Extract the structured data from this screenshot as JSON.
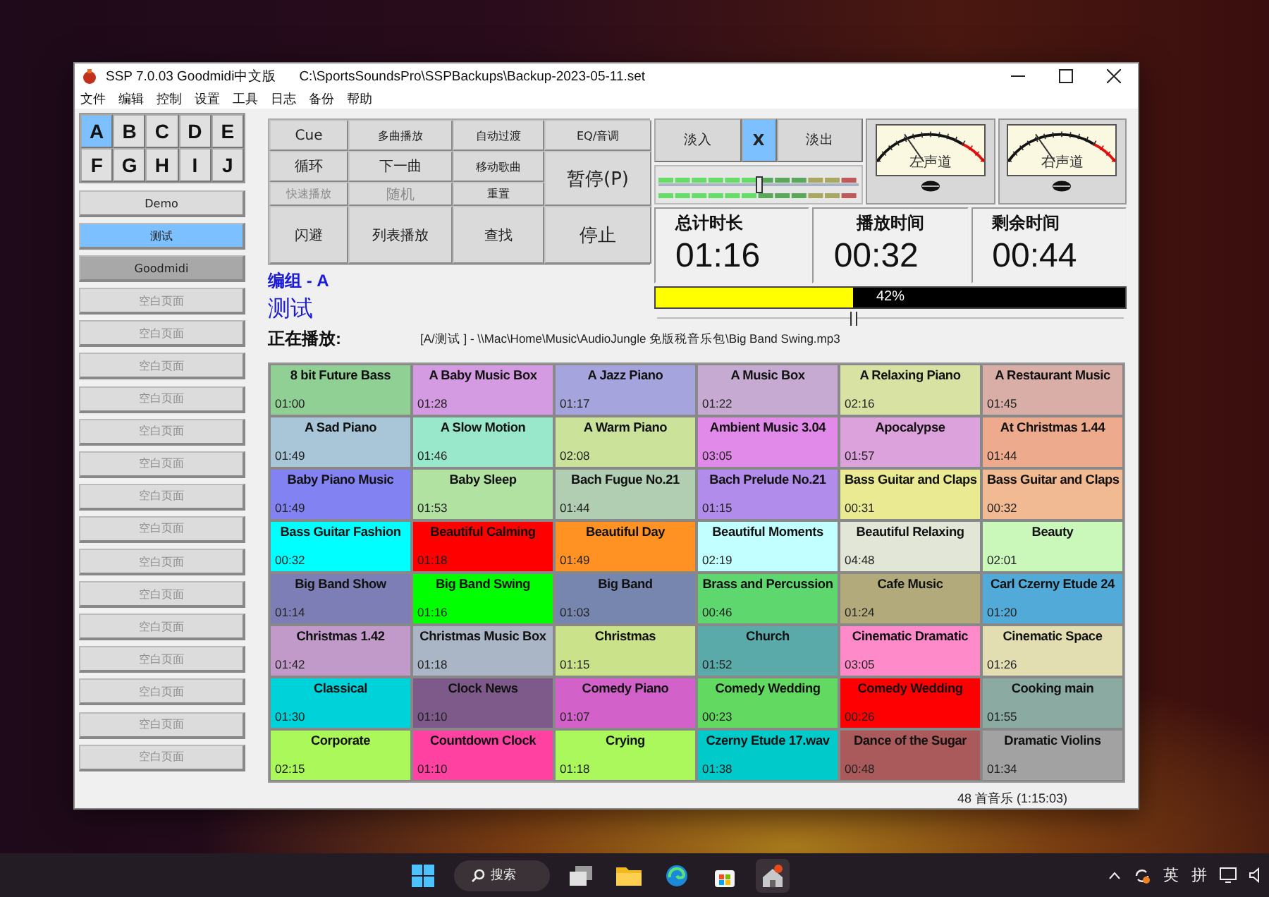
{
  "window": {
    "title": "SSP 7.0.03 Goodmidi中文版",
    "file_path": "C:\\SportsSoundsPro\\SSPBackups\\Backup-2023-05-11.set"
  },
  "menu": [
    "文件",
    "编辑",
    "控制",
    "设置",
    "工具",
    "日志",
    "备份",
    "帮助"
  ],
  "letters": [
    {
      "label": "A",
      "selected": true
    },
    {
      "label": "B",
      "selected": false
    },
    {
      "label": "C",
      "selected": false
    },
    {
      "label": "D",
      "selected": false
    },
    {
      "label": "E",
      "selected": false
    },
    {
      "label": "F",
      "selected": false
    },
    {
      "label": "G",
      "selected": false
    },
    {
      "label": "H",
      "selected": false
    },
    {
      "label": "I",
      "selected": false
    },
    {
      "label": "J",
      "selected": false
    }
  ],
  "pages": [
    {
      "label": "Demo",
      "selected": false,
      "shaded": false,
      "disabled": false
    },
    {
      "label": "测试",
      "selected": true,
      "shaded": false,
      "disabled": false
    },
    {
      "label": "Goodmidi",
      "selected": false,
      "shaded": true,
      "disabled": false
    },
    {
      "label": "空白页面",
      "selected": false,
      "shaded": false,
      "disabled": true
    },
    {
      "label": "空白页面",
      "selected": false,
      "shaded": false,
      "disabled": true
    },
    {
      "label": "空白页面",
      "selected": false,
      "shaded": false,
      "disabled": true
    },
    {
      "label": "空白页面",
      "selected": false,
      "shaded": false,
      "disabled": true
    },
    {
      "label": "空白页面",
      "selected": false,
      "shaded": false,
      "disabled": true
    },
    {
      "label": "空白页面",
      "selected": false,
      "shaded": false,
      "disabled": true
    },
    {
      "label": "空白页面",
      "selected": false,
      "shaded": false,
      "disabled": true
    },
    {
      "label": "空白页面",
      "selected": false,
      "shaded": false,
      "disabled": true
    },
    {
      "label": "空白页面",
      "selected": false,
      "shaded": false,
      "disabled": true
    },
    {
      "label": "空白页面",
      "selected": false,
      "shaded": false,
      "disabled": true
    },
    {
      "label": "空白页面",
      "selected": false,
      "shaded": false,
      "disabled": true
    },
    {
      "label": "空白页面",
      "selected": false,
      "shaded": false,
      "disabled": true
    },
    {
      "label": "空白页面",
      "selected": false,
      "shaded": false,
      "disabled": true
    },
    {
      "label": "空白页面",
      "selected": false,
      "shaded": false,
      "disabled": true
    },
    {
      "label": "空白页面",
      "selected": false,
      "shaded": false,
      "disabled": true
    }
  ],
  "controls": [
    {
      "label": "Cue",
      "kind": "normal",
      "disabled": false
    },
    {
      "label": "多曲播放",
      "kind": "small",
      "disabled": false
    },
    {
      "label": "自动过渡",
      "kind": "small",
      "disabled": false
    },
    {
      "label": "EQ/音调",
      "kind": "small",
      "disabled": false
    },
    {
      "label": "循环",
      "kind": "normal",
      "disabled": false
    },
    {
      "label": "下一曲",
      "kind": "normal",
      "disabled": false
    },
    {
      "label": "移动歌曲",
      "kind": "small",
      "disabled": false
    },
    {
      "label": "暂停(P)",
      "kind": "large",
      "disabled": false
    },
    {
      "label": "快速播放",
      "kind": "small",
      "disabled": true
    },
    {
      "label": "随机",
      "kind": "normal",
      "disabled": true
    },
    {
      "label": "重置",
      "kind": "small",
      "disabled": false
    },
    {
      "label": "闪避",
      "kind": "normal",
      "disabled": false
    },
    {
      "label": "列表播放",
      "kind": "normal",
      "disabled": false
    },
    {
      "label": "查找",
      "kind": "normal",
      "disabled": false
    },
    {
      "label": "停止",
      "kind": "large",
      "disabled": false
    }
  ],
  "group": {
    "label": "编组 - A",
    "page": "测试"
  },
  "fade_buttons": [
    {
      "label": "淡入",
      "selected": false
    },
    {
      "label": "X",
      "selected": true
    },
    {
      "label": "淡出",
      "selected": false
    }
  ],
  "mixer": {
    "level": 0.5
  },
  "vu_meters": [
    {
      "label": "左声道"
    },
    {
      "label": "右声道"
    }
  ],
  "timers": [
    {
      "label": "总计时长",
      "value": "01:16"
    },
    {
      "label": "播放时间",
      "value": "00:32"
    },
    {
      "label": "剩余时间",
      "value": "00:44"
    }
  ],
  "progress": {
    "level": 0.42,
    "text": "42%"
  },
  "seek": {
    "level": 0.42
  },
  "now_playing": {
    "label": "正在播放:",
    "path": "[A/测试 ] - \\\\Mac\\Home\\Music\\AudioJungle 免版税音乐包\\Big Band Swing.mp3"
  },
  "tracks": [
    {
      "title": "8 bit Future Bass",
      "time": "01:00",
      "color": "#90d094"
    },
    {
      "title": "A Baby Music Box",
      "time": "01:28",
      "color": "#d49ae2"
    },
    {
      "title": "A Jazz Piano",
      "time": "01:17",
      "color": "#a6a4dc"
    },
    {
      "title": "A Music Box",
      "time": "01:22",
      "color": "#c6aad2"
    },
    {
      "title": "A Relaxing Piano",
      "time": "02:16",
      "color": "#d8e2a2"
    },
    {
      "title": "A Restaurant Music",
      "time": "01:45",
      "color": "#d8aea6"
    },
    {
      "title": "A Sad Piano",
      "time": "01:49",
      "color": "#a8c6d8"
    },
    {
      "title": "A Slow Motion",
      "time": "01:46",
      "color": "#9ae8cc"
    },
    {
      "title": "A Warm Piano",
      "time": "02:08",
      "color": "#cae29a"
    },
    {
      "title": "Ambient Music 3.04",
      "time": "03:05",
      "color": "#e28aea"
    },
    {
      "title": "Apocalypse",
      "time": "01:57",
      "color": "#dca2dc"
    },
    {
      "title": "At Christmas 1.44",
      "time": "01:44",
      "color": "#eeaa8c"
    },
    {
      "title": "Baby Piano Music",
      "time": "01:49",
      "color": "#8282f2"
    },
    {
      "title": "Baby Sleep",
      "time": "01:53",
      "color": "#b2e2a2"
    },
    {
      "title": "Bach Fugue No.21",
      "time": "01:44",
      "color": "#b2ceb2"
    },
    {
      "title": "Bach Prelude No.21",
      "time": "01:15",
      "color": "#b28cea"
    },
    {
      "title": "Bass Guitar and Claps",
      "time": "00:31",
      "color": "#eaea92"
    },
    {
      "title": "Bass Guitar and Claps",
      "time": "00:32",
      "color": "#f2ba92"
    },
    {
      "title": "Bass Guitar Fashion",
      "time": "00:32",
      "color": "#00ffff"
    },
    {
      "title": "Beautiful Calming",
      "time": "01:18",
      "color": "#ff0000"
    },
    {
      "title": "Beautiful Day",
      "time": "01:49",
      "color": "#ff9222"
    },
    {
      "title": "Beautiful Moments",
      "time": "02:19",
      "color": "#c2ffff"
    },
    {
      "title": "Beautiful Relaxing",
      "time": "04:48",
      "color": "#e2e6d6"
    },
    {
      "title": "Beauty",
      "time": "02:01",
      "color": "#caf8ba"
    },
    {
      "title": "Big Band Show",
      "time": "01:14",
      "color": "#7e7eb6"
    },
    {
      "title": "Big Band Swing",
      "time": "01:16",
      "color": "#00ff00"
    },
    {
      "title": "Big Band",
      "time": "01:03",
      "color": "#7686ae"
    },
    {
      "title": "Brass and Percussion",
      "time": "00:46",
      "color": "#5ed86e"
    },
    {
      "title": "Cafe Music",
      "time": "01:24",
      "color": "#b2aa7a"
    },
    {
      "title": "Carl Czerny Etude 24",
      "time": "01:20",
      "color": "#52aad8"
    },
    {
      "title": "Christmas 1.42",
      "time": "01:42",
      "color": "#c29aca"
    },
    {
      "title": "Christmas Music Box",
      "time": "01:18",
      "color": "#aab6c6"
    },
    {
      "title": "Christmas",
      "time": "01:15",
      "color": "#cae28a"
    },
    {
      "title": "Church",
      "time": "01:52",
      "color": "#5aaaaa"
    },
    {
      "title": "Cinematic Dramatic",
      "time": "03:05",
      "color": "#ff8aca"
    },
    {
      "title": "Cinematic Space",
      "time": "01:26",
      "color": "#e2deb2"
    },
    {
      "title": "Classical",
      "time": "01:30",
      "color": "#00d2da"
    },
    {
      "title": "Clock News",
      "time": "01:10",
      "color": "#7e5a8a"
    },
    {
      "title": "Comedy Piano",
      "time": "01:07",
      "color": "#d262ca"
    },
    {
      "title": "Comedy Wedding",
      "time": "00:23",
      "color": "#62da62"
    },
    {
      "title": "Comedy Wedding",
      "time": "00:26",
      "color": "#ff0002"
    },
    {
      "title": "Cooking main",
      "time": "01:55",
      "color": "#8aaaa2"
    },
    {
      "title": "Corporate",
      "time": "02:15",
      "color": "#aaf85a"
    },
    {
      "title": "Countdown Clock",
      "time": "01:10",
      "color": "#ff42a2"
    },
    {
      "title": "Crying",
      "time": "01:18",
      "color": "#aaf85c"
    },
    {
      "title": "Czerny Etude 17.wav",
      "time": "01:38",
      "color": "#00caca"
    },
    {
      "title": "Dance of the Sugar",
      "time": "00:48",
      "color": "#aa5a5a"
    },
    {
      "title": "Dramatic Violins",
      "time": "01:34",
      "color": "#a2a2a2"
    }
  ],
  "status_bar": "48 首音乐 (1:15:03)",
  "taskbar": {
    "search": "搜索",
    "input_modes": [
      "英",
      "拼"
    ]
  }
}
